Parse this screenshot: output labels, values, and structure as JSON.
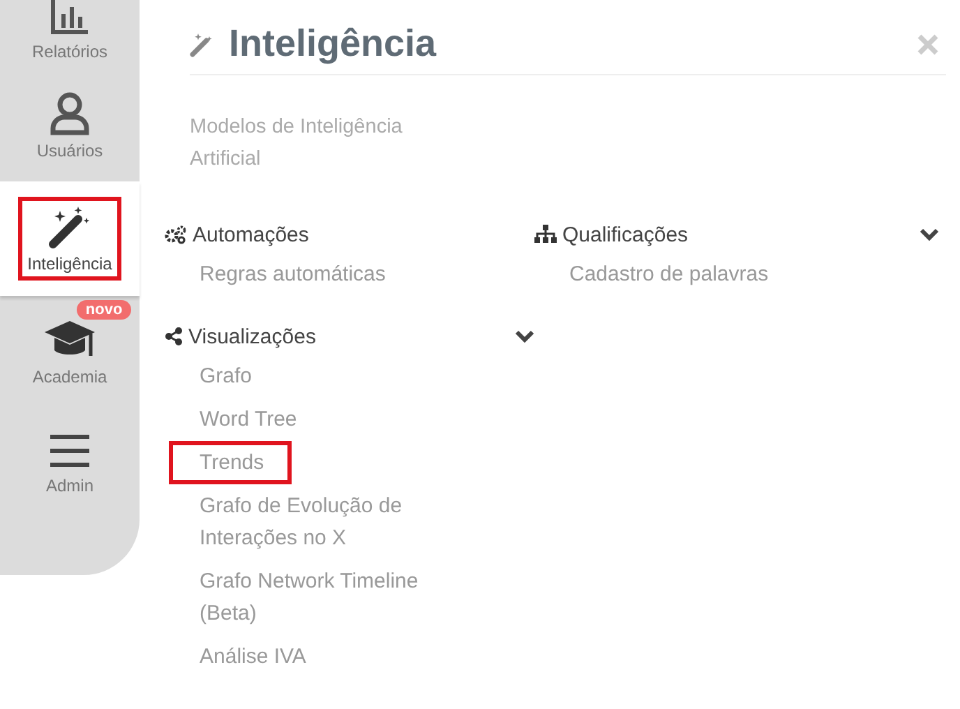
{
  "sidebar": {
    "items": [
      {
        "label": "Relatórios",
        "selected": false,
        "highlighted": false
      },
      {
        "label": "Usuários",
        "selected": false,
        "highlighted": false
      },
      {
        "label": "Inteligência",
        "selected": true,
        "highlighted": true
      },
      {
        "label": "Academia",
        "selected": false,
        "highlighted": false,
        "badge": "novo"
      },
      {
        "label": "Admin",
        "selected": false,
        "highlighted": false
      }
    ]
  },
  "panel": {
    "title": "Inteligência",
    "description": "Modelos de Inteligência Artificial",
    "columns": [
      [
        {
          "title": "Automações",
          "collapsible": false,
          "items": [
            {
              "label": "Regras automáticas",
              "highlighted": false
            }
          ]
        },
        {
          "title": "Visualizações",
          "collapsible": true,
          "items": [
            {
              "label": "Grafo",
              "highlighted": false
            },
            {
              "label": "Word Tree",
              "highlighted": false
            },
            {
              "label": "Trends",
              "highlighted": true
            },
            {
              "label": "Grafo de Evolução de Interações no X",
              "highlighted": false
            },
            {
              "label": "Grafo Network Timeline (Beta)",
              "highlighted": false
            },
            {
              "label": "Análise IVA",
              "highlighted": false
            }
          ]
        }
      ],
      [
        {
          "title": "Qualificações",
          "collapsible": true,
          "items": [
            {
              "label": "Cadastro de palavras",
              "highlighted": false
            }
          ]
        }
      ]
    ]
  }
}
